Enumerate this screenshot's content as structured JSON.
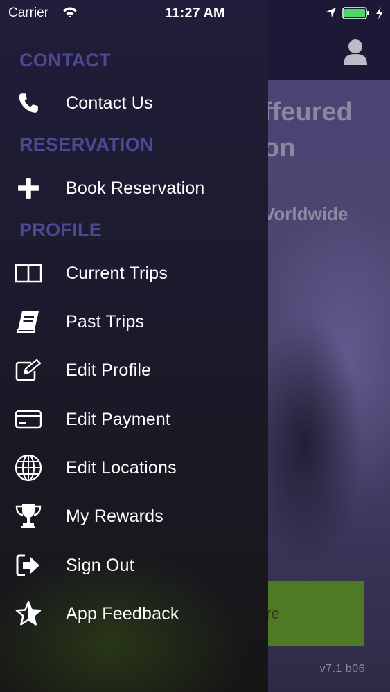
{
  "status_bar": {
    "carrier": "Carrier",
    "time": "11:27 AM"
  },
  "background": {
    "headline": "ffeured\non",
    "subtitle": "Vorldwide",
    "cta_fragment": "re",
    "version": "v7.1  b06"
  },
  "colors": {
    "section_header": "#4d4892",
    "cta": "#4f7a23",
    "battery": "#4cd964"
  },
  "menu": {
    "sections": [
      {
        "title": "CONTACT",
        "items": [
          {
            "label": "Contact Us",
            "icon": "phone-icon"
          }
        ]
      },
      {
        "title": "RESERVATION",
        "items": [
          {
            "label": "Book Reservation",
            "icon": "plus-icon"
          }
        ]
      },
      {
        "title": "PROFILE",
        "items": [
          {
            "label": "Current Trips",
            "icon": "open-book-icon"
          },
          {
            "label": "Past Trips",
            "icon": "closed-book-icon"
          },
          {
            "label": "Edit Profile",
            "icon": "edit-icon"
          },
          {
            "label": "Edit Payment",
            "icon": "credit-card-icon"
          },
          {
            "label": "Edit Locations",
            "icon": "globe-icon"
          },
          {
            "label": "My Rewards",
            "icon": "trophy-icon"
          },
          {
            "label": "Sign Out",
            "icon": "sign-out-icon"
          },
          {
            "label": "App Feedback",
            "icon": "star-icon"
          }
        ]
      }
    ]
  }
}
